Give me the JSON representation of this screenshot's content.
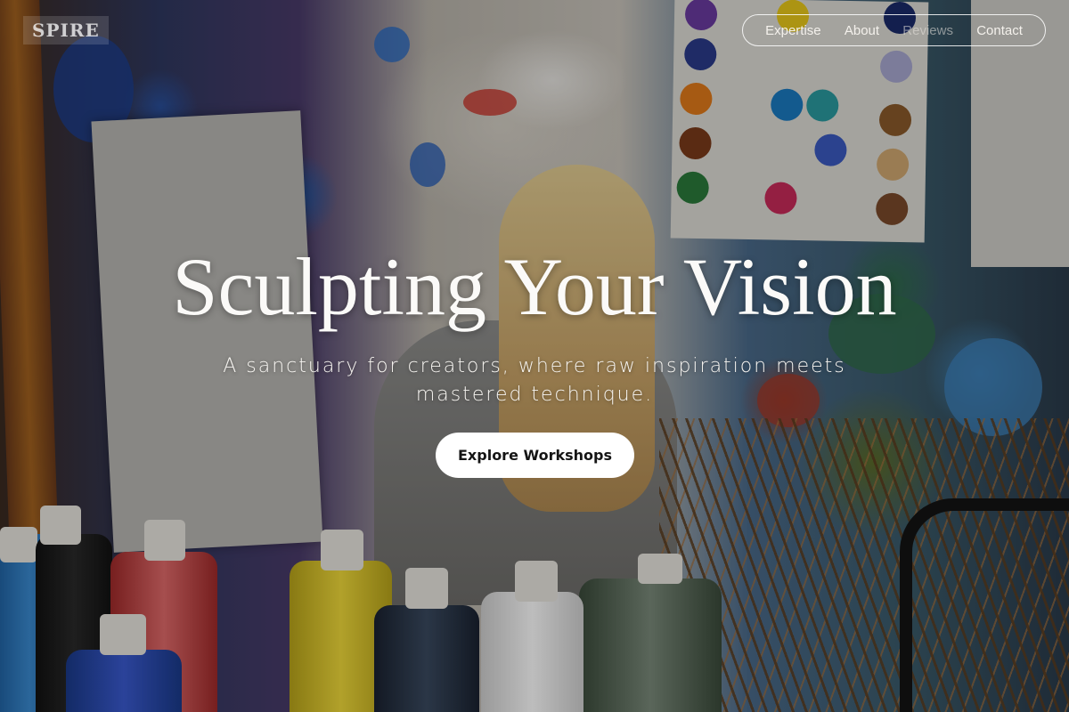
{
  "brand": {
    "logo_text": "SPIRE"
  },
  "nav": {
    "items": [
      {
        "label": "Expertise"
      },
      {
        "label": "About"
      },
      {
        "label": "Reviews"
      },
      {
        "label": "Contact"
      }
    ]
  },
  "hero": {
    "title": "Sculpting Your Vision",
    "subtitle": "A sanctuary for creators, where raw inspiration meets mastered technique.",
    "cta_label": "Explore Workshops"
  },
  "colors": {
    "cta_background": "#ffffff",
    "cta_text": "#151515",
    "text_primary": "#fbfaf8"
  }
}
